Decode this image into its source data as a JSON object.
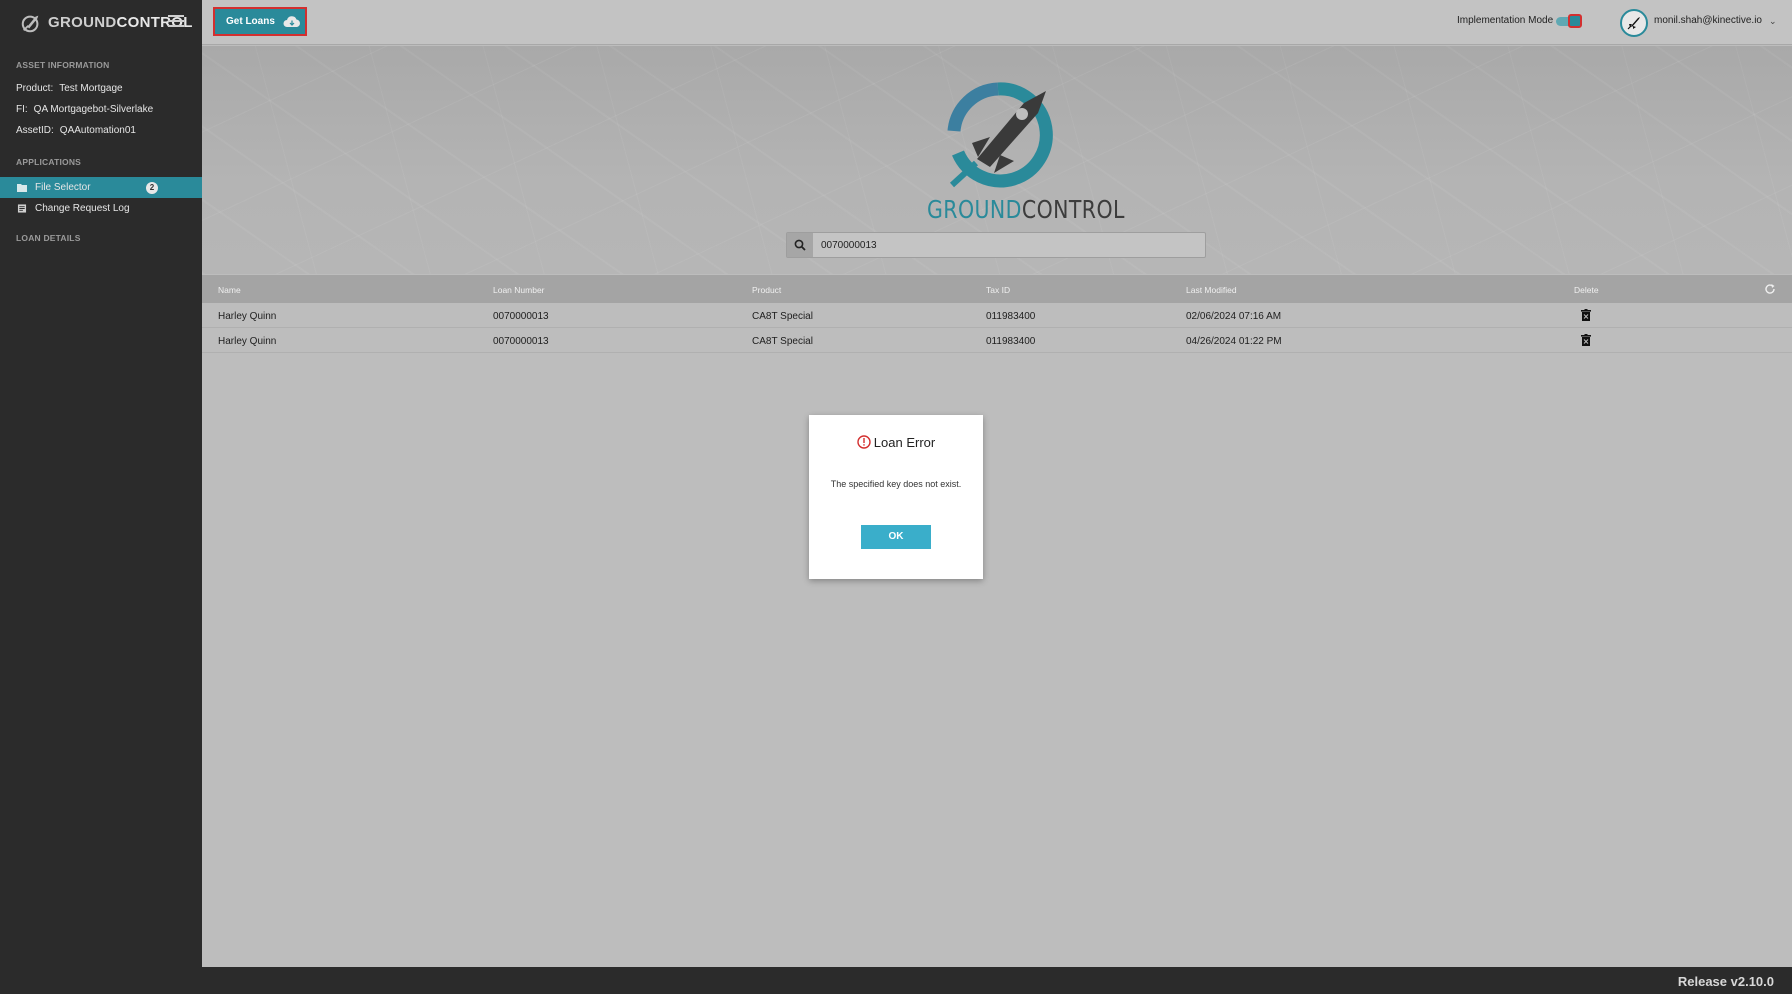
{
  "app": {
    "brand_prefix": "GROUND",
    "brand_suffix": "CONTROL"
  },
  "sidebar": {
    "asset_section": "ASSET INFORMATION",
    "asset": [
      {
        "key": "Product:",
        "value": "Test Mortgage"
      },
      {
        "key": "FI:",
        "value": "QA Mortgagebot-Silverlake"
      },
      {
        "key": "AssetID:",
        "value": "QAAutomation01"
      }
    ],
    "applications_section": "APPLICATIONS",
    "items": [
      {
        "label": "File Selector",
        "badge": "2",
        "icon": "folder-icon"
      },
      {
        "label": "Change Request Log",
        "icon": "document-icon"
      }
    ],
    "loan_details_section": "LOAN DETAILS"
  },
  "topbar": {
    "get_loans_label": "Get Loans",
    "implementation_mode_label": "Implementation Mode",
    "implementation_mode_on": true,
    "user_email": "monil.shah@kinective.io"
  },
  "hero": {
    "title_prefix": "GROUND",
    "title_suffix": "CONTROL",
    "search_value": "0070000013"
  },
  "table": {
    "columns": [
      "Name",
      "Loan Number",
      "Product",
      "Tax ID",
      "Last Modified",
      "Delete"
    ],
    "rows": [
      {
        "name": "Harley Quinn",
        "loan_number": "0070000013",
        "product": "CA8T Special",
        "tax_id": "011983400",
        "last_modified": "02/06/2024 07:16 AM"
      },
      {
        "name": "Harley Quinn",
        "loan_number": "0070000013",
        "product": "CA8T Special",
        "tax_id": "011983400",
        "last_modified": "04/26/2024 01:22 PM"
      }
    ]
  },
  "modal": {
    "title": "Loan Error",
    "message": "The specified key does not exist.",
    "ok_label": "OK"
  },
  "footer": {
    "release": "Release v2.10.0"
  },
  "colors": {
    "accent": "#2a8a9a",
    "ok_button": "#3aaeca",
    "highlight_border": "#d32f2f",
    "sidebar_bg": "#2b2b2b"
  }
}
